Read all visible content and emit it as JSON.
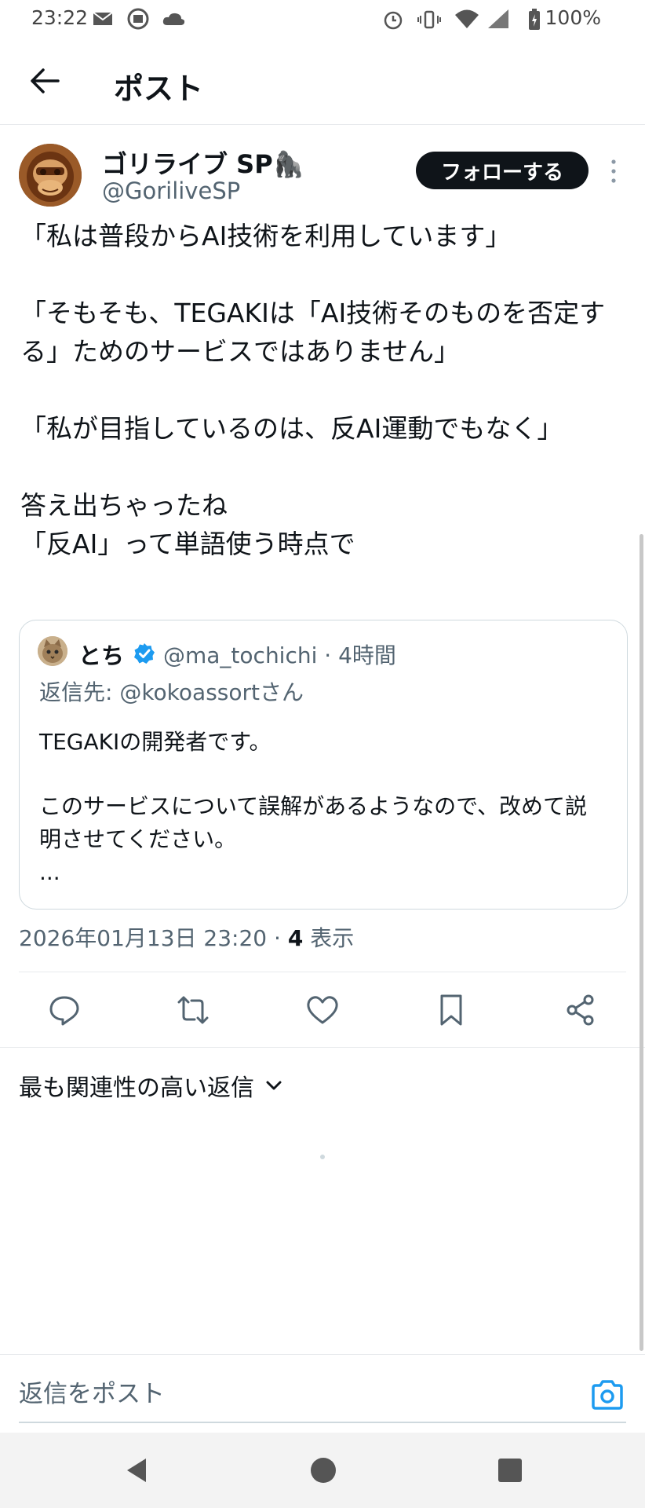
{
  "status_bar": {
    "time": "23:22",
    "battery": "100%"
  },
  "header": {
    "title": "ポスト"
  },
  "post": {
    "author": {
      "display_name": "ゴリライブ SP🦍",
      "handle": "@GoriliveSP"
    },
    "follow_label": "フォローする",
    "body": [
      "「私は普段からAI技術を利用しています」",
      "",
      "「そもそも、TEGAKIは「AI技術そのものを否定する」ためのサービスではありません」",
      "",
      "「私が目指しているのは、反AI運動でもなく」",
      "",
      "答え出ちゃったね",
      "「反AI」って単語使う時点で"
    ],
    "quoted": {
      "name": "とち",
      "handle_time": "@ma_tochichi · 4時間",
      "reply_to": "返信先: @kokoassortさん",
      "body": [
        "TEGAKIの開発者です。",
        "",
        "このサービスについて誤解があるようなので、改めて説明させてください。",
        "..."
      ]
    },
    "timestamp": "2026年01月13日 23:20 · ",
    "views_count": "4",
    "views_label": " 表示"
  },
  "replies": {
    "sort_label": "最も関連性の高い返信"
  },
  "composer": {
    "placeholder": "返信をポスト"
  },
  "colors": {
    "text": "#0f1419",
    "secondary": "#536471",
    "accent": "#1d9bf0",
    "divider": "#e8eaed"
  },
  "icons": [
    "back-arrow-icon",
    "more-vertical-icon",
    "verified-badge-icon",
    "reply-icon",
    "repost-icon",
    "like-icon",
    "bookmark-icon",
    "share-icon",
    "chevron-down-icon",
    "camera-icon",
    "nav-back-icon",
    "nav-home-icon",
    "nav-recents-icon"
  ]
}
